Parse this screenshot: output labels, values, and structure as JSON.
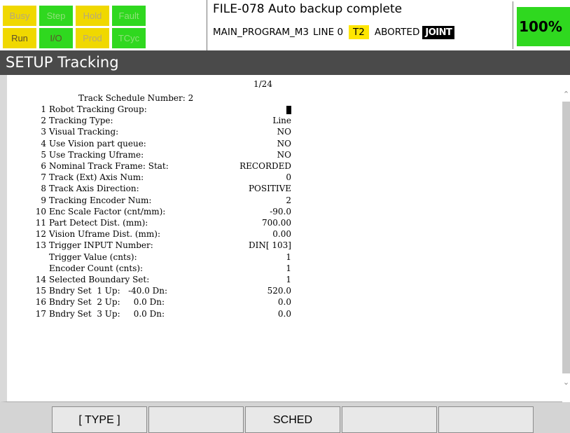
{
  "status": {
    "indicators": [
      {
        "label": "Busy",
        "active": false,
        "color": "#f0d800"
      },
      {
        "label": "Step",
        "active": false,
        "color": "#2fd81f"
      },
      {
        "label": "Hold",
        "active": false,
        "color": "#f0d800"
      },
      {
        "label": "Fault",
        "active": false,
        "color": "#2fd81f"
      },
      {
        "label": "Run",
        "active": false,
        "color": "#f0d800"
      },
      {
        "label": "I/O",
        "active": true,
        "color": "#2fd81f"
      },
      {
        "label": "Prod",
        "active": false,
        "color": "#f0d800"
      },
      {
        "label": "TCyc",
        "active": false,
        "color": "#2fd81f"
      }
    ],
    "alarm_message": "FILE-078 Auto backup complete",
    "program": "MAIN_PROGRAM_M3",
    "line": "LINE 0",
    "mode": "T2",
    "state": "ABORTED",
    "coord": "JOINT",
    "override": "100%"
  },
  "title": "SETUP Tracking",
  "page_indicator": "1/24",
  "schedule_label": "Track Schedule Number: 2",
  "items": [
    {
      "num": "1",
      "label": "Robot Tracking Group:",
      "value": "1",
      "cursor": true
    },
    {
      "num": "2",
      "label": "Tracking Type:",
      "value": "Line"
    },
    {
      "num": "3",
      "label": "Visual Tracking:",
      "value": "NO"
    },
    {
      "num": "4",
      "label": "Use Vision part queue:",
      "value": "NO"
    },
    {
      "num": "5",
      "label": "Use Tracking Uframe:",
      "value": "NO"
    },
    {
      "num": "6",
      "label": "Nominal Track Frame: Stat:",
      "value": "RECORDED"
    },
    {
      "num": "7",
      "label": "Track (Ext) Axis Num:",
      "value": "0"
    },
    {
      "num": "8",
      "label": "Track Axis Direction:",
      "value": "POSITIVE"
    },
    {
      "num": "9",
      "label": "Tracking Encoder Num:",
      "value": "2"
    },
    {
      "num": "10",
      "label": "Enc Scale Factor (cnt/mm):",
      "value": "-90.0"
    },
    {
      "num": "11",
      "label": "Part Detect Dist. (mm):",
      "value": "700.00"
    },
    {
      "num": "12",
      "label": "Vision Uframe Dist. (mm):",
      "value": "0.00"
    },
    {
      "num": "13",
      "label": "Trigger INPUT Number:",
      "value": "DIN[ 103]"
    },
    {
      "num": "",
      "label": "Trigger Value (cnts):",
      "value": "1"
    },
    {
      "num": "",
      "label": "Encoder Count (cnts):",
      "value": "1"
    },
    {
      "num": "14",
      "label": "Selected Boundary Set:",
      "value": "1"
    },
    {
      "num": "15",
      "label": "Bndry Set  1 Up:   -40.0 Dn:",
      "value": "520.0"
    },
    {
      "num": "16",
      "label": "Bndry Set  2 Up:     0.0 Dn:",
      "value": "0.0"
    },
    {
      "num": "17",
      "label": "Bndry Set  3 Up:     0.0 Dn:",
      "value": "0.0"
    }
  ],
  "function_keys": [
    "[ TYPE ]",
    "",
    "SCHED",
    "",
    ""
  ]
}
